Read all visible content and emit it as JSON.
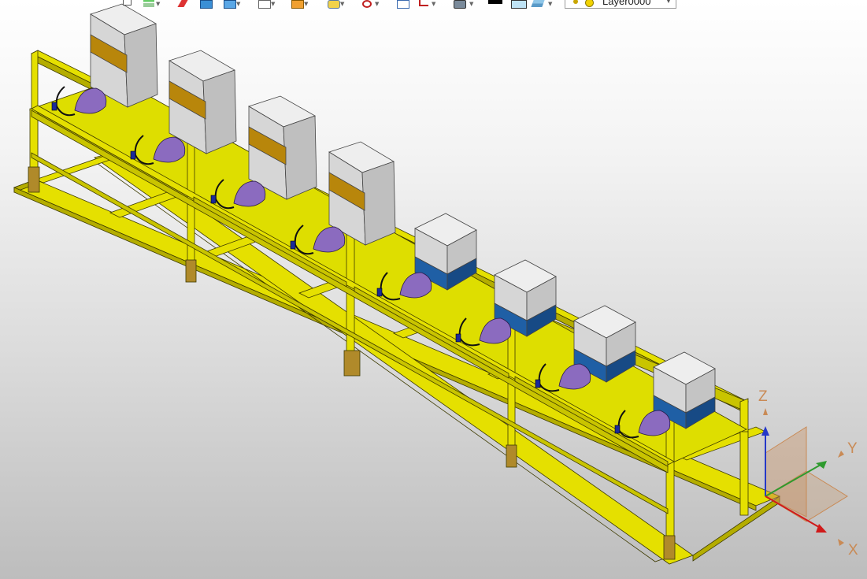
{
  "toolbar": {
    "icons": [
      "rotate-view-icon",
      "layers-stack-icon",
      "pencil-icon",
      "blue-box-icon",
      "blue-solid-icon",
      "wireframe-box-icon",
      "orange-box-icon",
      "camera-icon",
      "target-icon",
      "clipboard-icon",
      "corner-frame-icon",
      "monitor-icon",
      "black-swatch-icon",
      "light-blue-swatch-icon",
      "tile-stack-icon"
    ],
    "layer_value": "Layer0000"
  },
  "triad": {
    "z_label": "Z",
    "y_label": "Y",
    "x_label": "X"
  },
  "colors": {
    "frame": "#e5e000",
    "frame_dark": "#b4ad00",
    "frame_edge": "#3d3a00",
    "shelf": "#dede00",
    "post_foot": "#b08a2a",
    "cabinet": "#d6d6d6",
    "cabinet_band": "#b8860b",
    "printer_base": "#1f5fa5",
    "fan": "#8b6bbf",
    "z_axis": "#2438c8",
    "y_axis": "#2e9a2e",
    "x_axis": "#d01a1a",
    "plane": "#c98a55"
  }
}
